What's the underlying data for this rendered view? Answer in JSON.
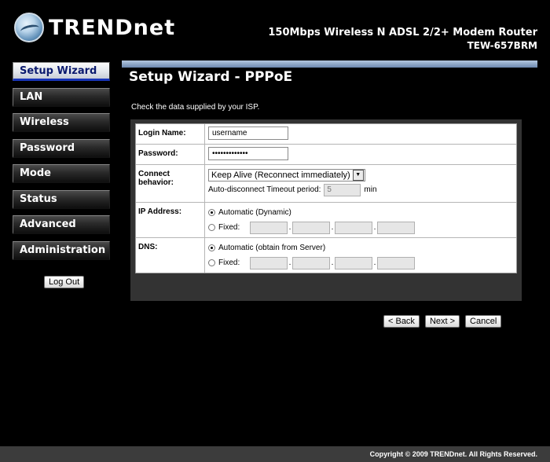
{
  "brand": {
    "logo_text": "TRENDnet"
  },
  "product": {
    "name": "150Mbps Wireless N ADSL 2/2+ Modem Router",
    "model": "TEW-657BRM"
  },
  "sidebar": {
    "items": [
      {
        "label": "Setup Wizard",
        "active": true
      },
      {
        "label": "LAN"
      },
      {
        "label": "Wireless"
      },
      {
        "label": "Password"
      },
      {
        "label": "Mode"
      },
      {
        "label": "Status"
      },
      {
        "label": "Advanced"
      },
      {
        "label": "Administration"
      }
    ],
    "logout_label": "Log Out"
  },
  "main": {
    "title": "Setup Wizard - PPPoE",
    "hint": "Check the data supplied by your ISP."
  },
  "form": {
    "login_label": "Login Name:",
    "login_value": "username",
    "password_label": "Password:",
    "password_value": "•••••••••••••",
    "connect_label": "Connect behavior:",
    "connect_value": "Keep Alive (Reconnect immediately)",
    "timeout_label": "Auto-disconnect Timeout period:",
    "timeout_value": "5",
    "timeout_unit": "min",
    "ip_label": "IP Address:",
    "ip_auto": "Automatic (Dynamic)",
    "ip_fixed": "Fixed:",
    "dns_label": "DNS:",
    "dns_auto": "Automatic (obtain from Server)",
    "dns_fixed": "Fixed:"
  },
  "actions": {
    "back": "< Back",
    "next": "Next >",
    "cancel": "Cancel"
  },
  "footer": {
    "copyright": "Copyright © 2009 TRENDnet. All Rights Reserved."
  }
}
